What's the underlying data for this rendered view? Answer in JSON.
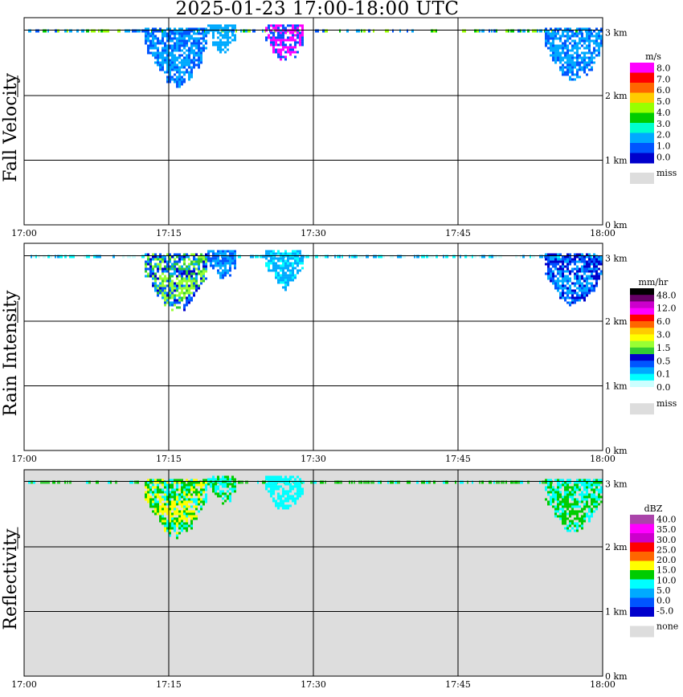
{
  "title": "2025-01-23   17:00-18:00 UTC",
  "chart_data": [
    {
      "type": "heatmap",
      "ylabel": "Fall Velocity",
      "x_ticks": [
        "17:00",
        "17:15",
        "17:30",
        "17:45",
        "18:00"
      ],
      "y_ticks": [
        "0 km",
        "1 km",
        "2 km",
        "3 km"
      ],
      "ylim_km": [
        0,
        3.2
      ],
      "grid": true,
      "background": "#ffffff",
      "legend": {
        "unit": "m/s",
        "labels": [
          "8.0",
          "7.0",
          "6.0",
          "5.0",
          "4.0",
          "3.0",
          "2.0",
          "1.0",
          "0.0"
        ],
        "colors": [
          "#ff00ff",
          "#ff0000",
          "#ff6600",
          "#ffcc00",
          "#99ff00",
          "#00cc00",
          "#00ffcc",
          "#00aaff",
          "#0055ff",
          "#0000cc"
        ],
        "missing_label": "miss"
      },
      "features": [
        {
          "t_min": 12.5,
          "t_max": 19.0,
          "h_top_km": 3.05,
          "h_bottom_km": 2.2,
          "colors": [
            "#0055ff",
            "#00aaff"
          ]
        },
        {
          "t_min": 19.0,
          "t_max": 22.0,
          "h_top_km": 3.1,
          "h_bottom_km": 2.7,
          "colors": [
            "#00aaff"
          ]
        },
        {
          "t_min": 25.0,
          "t_max": 29.0,
          "h_top_km": 3.1,
          "h_bottom_km": 2.55,
          "colors": [
            "#0055ff",
            "#ff00ff"
          ]
        },
        {
          "t_min": 54.0,
          "t_max": 60.0,
          "h_top_km": 3.05,
          "h_bottom_km": 2.25,
          "colors": [
            "#0055ff",
            "#00aaff"
          ]
        }
      ]
    },
    {
      "type": "heatmap",
      "ylabel": "Rain Intensity",
      "x_ticks": [
        "17:00",
        "17:15",
        "17:30",
        "17:45",
        "18:00"
      ],
      "y_ticks": [
        "0 km",
        "1 km",
        "2 km",
        "3 km"
      ],
      "ylim_km": [
        0,
        3.2
      ],
      "grid": true,
      "background": "#ffffff",
      "legend": {
        "unit": "mm/hr",
        "labels": [
          "48.0",
          "12.0",
          "6.0",
          "3.0",
          "1.5",
          "0.5",
          "0.1",
          "0.0"
        ],
        "colors": [
          "#000000",
          "#660066",
          "#cc00cc",
          "#ff00ff",
          "#ff0000",
          "#ff6600",
          "#ffcc00",
          "#ffff00",
          "#99ff33",
          "#33cc33",
          "#0000cc",
          "#0055ff",
          "#00aaff",
          "#00ffff",
          "#ccffff",
          "#ffffff"
        ],
        "missing_label": "miss"
      },
      "features": [
        {
          "t_min": 12.5,
          "t_max": 19.0,
          "h_top_km": 3.05,
          "h_bottom_km": 2.2,
          "colors": [
            "#0000cc",
            "#0055ff",
            "#00aaff",
            "#33cc33",
            "#99ff33"
          ]
        },
        {
          "t_min": 19.0,
          "t_max": 22.0,
          "h_top_km": 3.1,
          "h_bottom_km": 2.7,
          "colors": [
            "#0055ff",
            "#00aaff"
          ]
        },
        {
          "t_min": 25.0,
          "t_max": 29.0,
          "h_top_km": 3.1,
          "h_bottom_km": 2.55,
          "colors": [
            "#00ffff",
            "#00aaff"
          ]
        },
        {
          "t_min": 54.0,
          "t_max": 60.0,
          "h_top_km": 3.05,
          "h_bottom_km": 2.25,
          "colors": [
            "#0000cc",
            "#0055ff",
            "#00aaff"
          ]
        }
      ]
    },
    {
      "type": "heatmap",
      "ylabel": "Reflectivity",
      "x_ticks": [
        "17:00",
        "17:15",
        "17:30",
        "17:45",
        "18:00"
      ],
      "y_ticks": [
        "0 km",
        "1 km",
        "2 km",
        "3 km"
      ],
      "ylim_km": [
        0,
        3.2
      ],
      "grid": true,
      "background": "#dddddd",
      "legend": {
        "unit": "dBZ",
        "labels": [
          "40.0",
          "35.0",
          "30.0",
          "25.0",
          "20.0",
          "15.0",
          "10.0",
          "5.0",
          "0.0",
          "-5.0"
        ],
        "colors": [
          "#aa44aa",
          "#ff00ff",
          "#cc00cc",
          "#ff0000",
          "#ff6600",
          "#ffff00",
          "#00cc00",
          "#00ffff",
          "#00aaff",
          "#0055ff",
          "#0000cc"
        ],
        "missing_label": "none"
      },
      "features": [
        {
          "t_min": 12.5,
          "t_max": 19.0,
          "h_top_km": 3.05,
          "h_bottom_km": 2.2,
          "colors": [
            "#00ffff",
            "#00cc00",
            "#00cc00",
            "#ffff00"
          ]
        },
        {
          "t_min": 19.0,
          "t_max": 22.0,
          "h_top_km": 3.1,
          "h_bottom_km": 2.7,
          "colors": [
            "#00cc00",
            "#00ffff"
          ]
        },
        {
          "t_min": 25.0,
          "t_max": 29.0,
          "h_top_km": 3.1,
          "h_bottom_km": 2.55,
          "colors": [
            "#00ffff"
          ]
        },
        {
          "t_min": 54.0,
          "t_max": 60.0,
          "h_top_km": 3.05,
          "h_bottom_km": 2.25,
          "colors": [
            "#00ffff",
            "#00cc00"
          ]
        }
      ]
    }
  ]
}
